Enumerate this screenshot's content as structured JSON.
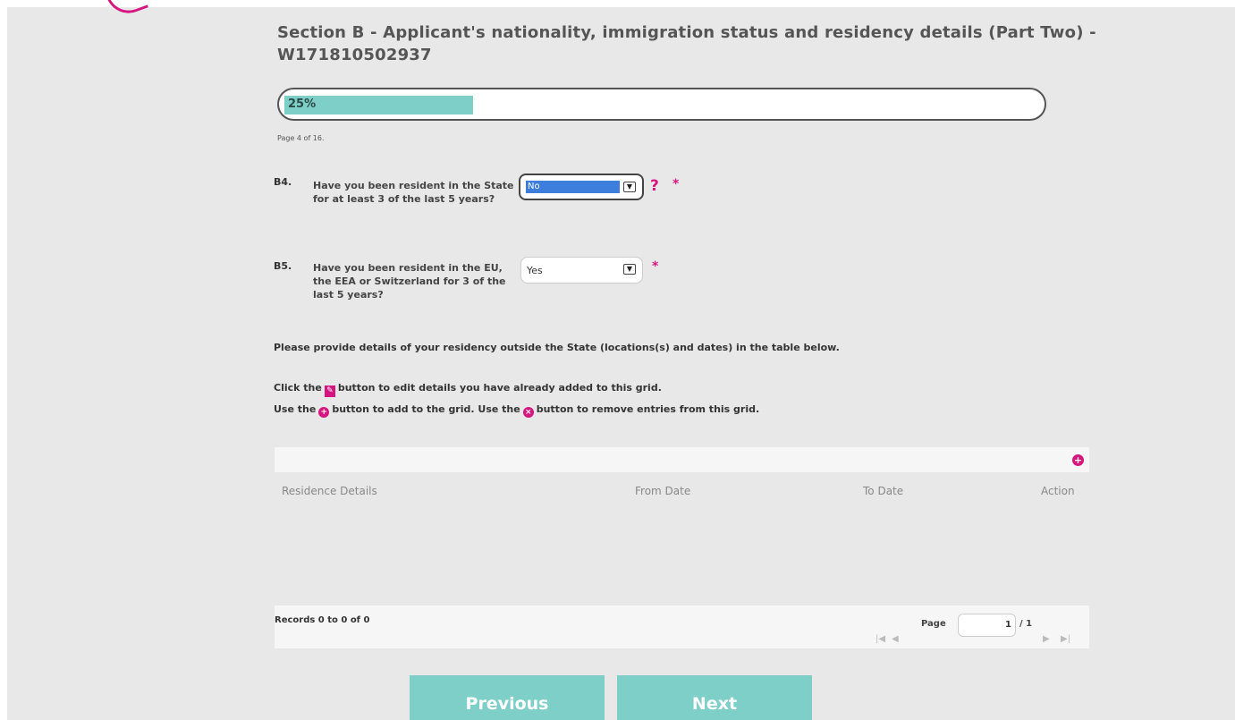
{
  "title": "Section B - Applicant's nationality, immigration status and residency details (Part Two) - W171810502937",
  "progress": {
    "value": 0.25,
    "label": "25%"
  },
  "page_indicator": "Page 4 of 16.",
  "questions": [
    {
      "num": "B4.",
      "text": "Have you been resident in the State for at least 3 of the last 5 years?",
      "value": "No",
      "help": "?",
      "required": "*"
    },
    {
      "num": "B5.",
      "text": "Have you been resident in the EU, the EEA or Switzerland for 3 of the last 5 years?",
      "value": "Yes",
      "required": "*"
    }
  ],
  "instructions": {
    "line1": "Please provide details of your residency outside the State (locations(s) and dates) in the table below.",
    "line2_a": "Click the",
    "line2_b": "button to edit details you have already added to this grid.",
    "line3_a": "Use the",
    "line3_b": "button to add to the grid. Use the",
    "line3_c": "button to remove entries from this grid."
  },
  "grid": {
    "columns": [
      "Residence Details",
      "From Date",
      "To Date",
      "Action"
    ],
    "records_text": "Records 0 to 0 of 0",
    "page_label": "Page",
    "page_value": "1",
    "page_total": "/ 1"
  },
  "buttons": {
    "previous": "Previous",
    "next": "Next"
  },
  "colors": {
    "accent": "#d6167f",
    "teal": "#7fcfc9",
    "panel": "#e8e8e8"
  }
}
